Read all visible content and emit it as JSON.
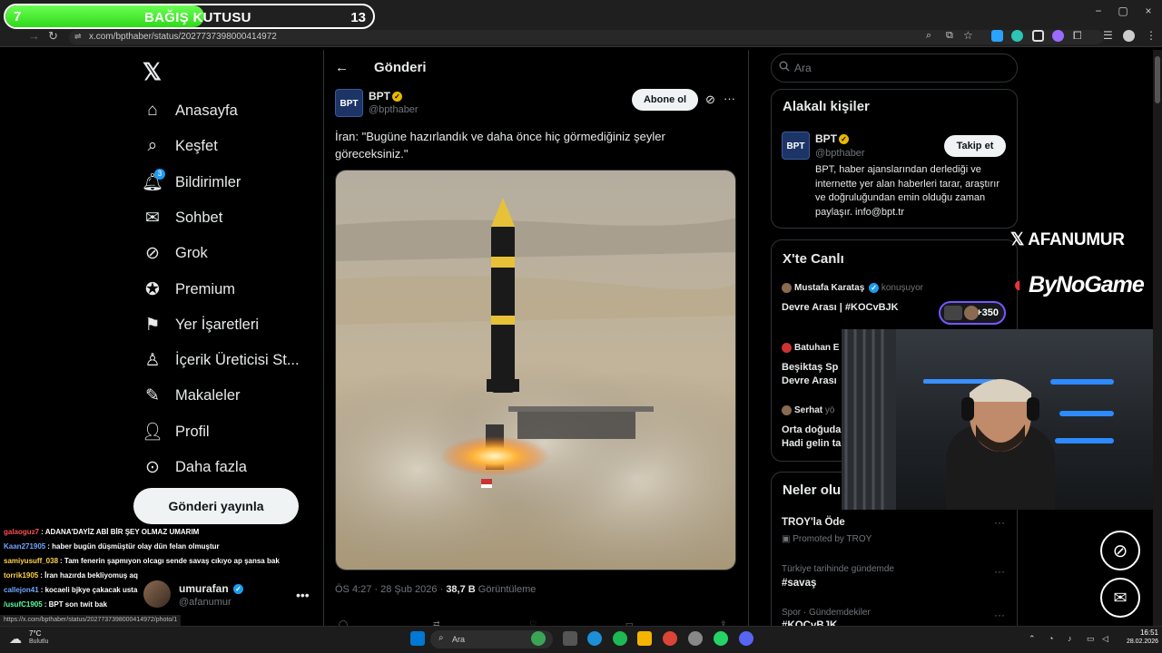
{
  "donation": {
    "left_count": "7",
    "title": "BAĞIŞ KUTUSU",
    "right_count": "13",
    "progress": 0.54
  },
  "browser": {
    "tab_close": "×",
    "tab_new": "+",
    "url": "x.com/bpthaber/status/2027737398000414972",
    "window_controls": [
      "−",
      "▢",
      "×"
    ],
    "status_link": "https://x.com/bpthaber/status/2027737398000414972/photo/1"
  },
  "nav": {
    "items": [
      {
        "label": "Anasayfa",
        "icon": "home-icon"
      },
      {
        "label": "Keşfet",
        "icon": "search-icon"
      },
      {
        "label": "Bildirimler",
        "icon": "bell-icon",
        "badge": "3"
      },
      {
        "label": "Sohbet",
        "icon": "mail-icon"
      },
      {
        "label": "Grok",
        "icon": "grok-icon"
      },
      {
        "label": "Premium",
        "icon": "premium-icon"
      },
      {
        "label": "Yer İşaretleri",
        "icon": "bookmark-icon"
      },
      {
        "label": "İçerik Üreticisi St...",
        "icon": "creator-icon"
      },
      {
        "label": "Makaleler",
        "icon": "articles-icon"
      },
      {
        "label": "Profil",
        "icon": "profile-icon"
      },
      {
        "label": "Daha fazla",
        "icon": "more-circle-icon"
      }
    ],
    "post_button": "Gönderi yayınla"
  },
  "chat": [
    {
      "user": "galaoguz7",
      "color": "#ff4d4d",
      "message": ": ADANA'DAYİZ ABİ BİR ŞEY OLMAZ UMARIM"
    },
    {
      "user": "Kaan271905",
      "color": "#6fa8ff",
      "message": ": haber bugün düşmüştür olay dün felan olmuştur"
    },
    {
      "user": "samiyusuff_038",
      "color": "#ffd24d",
      "message": ": Tam fenerin şapmıyon olcagı sende savaş cıkıyo ap şansa bak"
    },
    {
      "user": "torrik1905",
      "color": "#ffd24d",
      "message": ": İran hazırda bekliyomuş aq"
    },
    {
      "user": "callejon41",
      "color": "#6fa8ff",
      "message": ": kocaeli bjkye çakacak usta"
    },
    {
      "user": "/usufC1905",
      "color": "#5effa0",
      "message": ": BPT son twit bak"
    }
  ],
  "account": {
    "name": "umurafan",
    "handle": "@afanumur"
  },
  "post": {
    "header": "Gönderi",
    "author_name": "BPT",
    "author_handle": "@bpthaber",
    "avatar_text": "BPT",
    "follow_label": "Abone ol",
    "text": "İran: \"Bugüne hazırlandık ve daha önce hiç görmediğiniz şeyler göreceksiniz.\"",
    "time": "ÖS 4:27 · 28 Şub 2026 · ",
    "views": "38,7 B",
    "views_label": " Görüntüleme"
  },
  "right": {
    "search_placeholder": "Ara",
    "related_title": "Alakalı kişiler",
    "related": {
      "name": "BPT",
      "handle": "@bpthaber",
      "follow": "Takip et",
      "bio": "BPT, haber ajanslarından derlediği ve internette yer alan haberleri tarar, araştırır ve doğruluğundan emin olduğu zaman paylaşır. info@bpt.tr"
    },
    "live_title": "X'te Canlı",
    "live": [
      {
        "user": "Mustafa Karataş",
        "sub": " konuşuyor",
        "title": "Devre Arası | #KOCvBJK"
      },
      {
        "user": "Batuhan E",
        "sub": "",
        "title": "Beşiktaş Sp\nDevre Arası"
      },
      {
        "user": "Serhat",
        "sub": " yö",
        "title": "Orta doğuda\nHadi gelin ta"
      }
    ],
    "live_badge": "+350",
    "trends_title": "Neler olu",
    "trends": [
      {
        "ctx": "",
        "name": "TROY'la Öde",
        "promo": "Promoted by TROY"
      },
      {
        "ctx": "Türkiye tarihinde gündemde",
        "name": "#savaş",
        "promo": ""
      },
      {
        "ctx": "Spor · Gündemdekiler",
        "name": "#KOCvBJK",
        "promo": ""
      }
    ]
  },
  "overlay": {
    "brand1": "AFANUMUR",
    "brand2": "ByNoGame"
  },
  "taskbar": {
    "weather_temp": "7°C",
    "weather_desc": "Bulutlu",
    "search": "Ara",
    "time": "16:51",
    "date": "28.02.2026"
  }
}
